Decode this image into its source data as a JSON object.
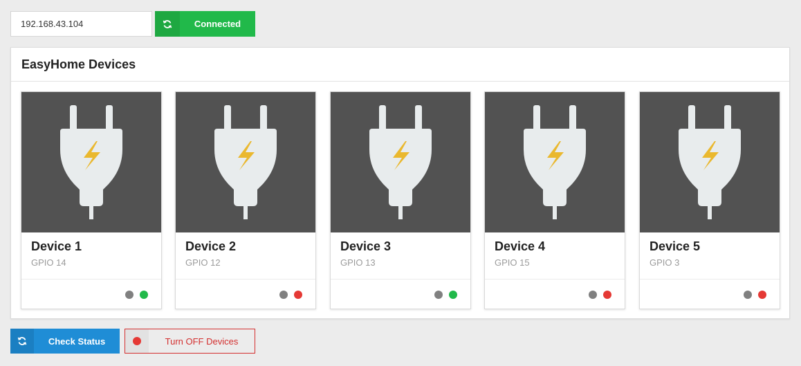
{
  "connection": {
    "ip_value": "192.168.43.104",
    "status_label": "Connected",
    "status_color": "#21b94a",
    "icon": "refresh-icon"
  },
  "panel": {
    "title": "EasyHome Devices"
  },
  "devices": [
    {
      "name": "Device 1",
      "gpio": "GPIO 14",
      "icon": "plug-icon",
      "indicator_1": "#808080",
      "indicator_2": "#21b94a"
    },
    {
      "name": "Device 2",
      "gpio": "GPIO 12",
      "icon": "plug-icon",
      "indicator_1": "#808080",
      "indicator_2": "#e53935"
    },
    {
      "name": "Device 3",
      "gpio": "GPIO 13",
      "icon": "plug-icon",
      "indicator_1": "#808080",
      "indicator_2": "#21b94a"
    },
    {
      "name": "Device 4",
      "gpio": "GPIO 15",
      "icon": "plug-icon",
      "indicator_1": "#808080",
      "indicator_2": "#e53935"
    },
    {
      "name": "Device 5",
      "gpio": "GPIO 3",
      "icon": "plug-icon",
      "indicator_1": "#808080",
      "indicator_2": "#e53935"
    }
  ],
  "actions": {
    "check_status_label": "Check Status",
    "check_status_color": "#1f8dd6",
    "turn_off_label": "Turn OFF Devices",
    "turn_off_color": "#d32f2f"
  }
}
